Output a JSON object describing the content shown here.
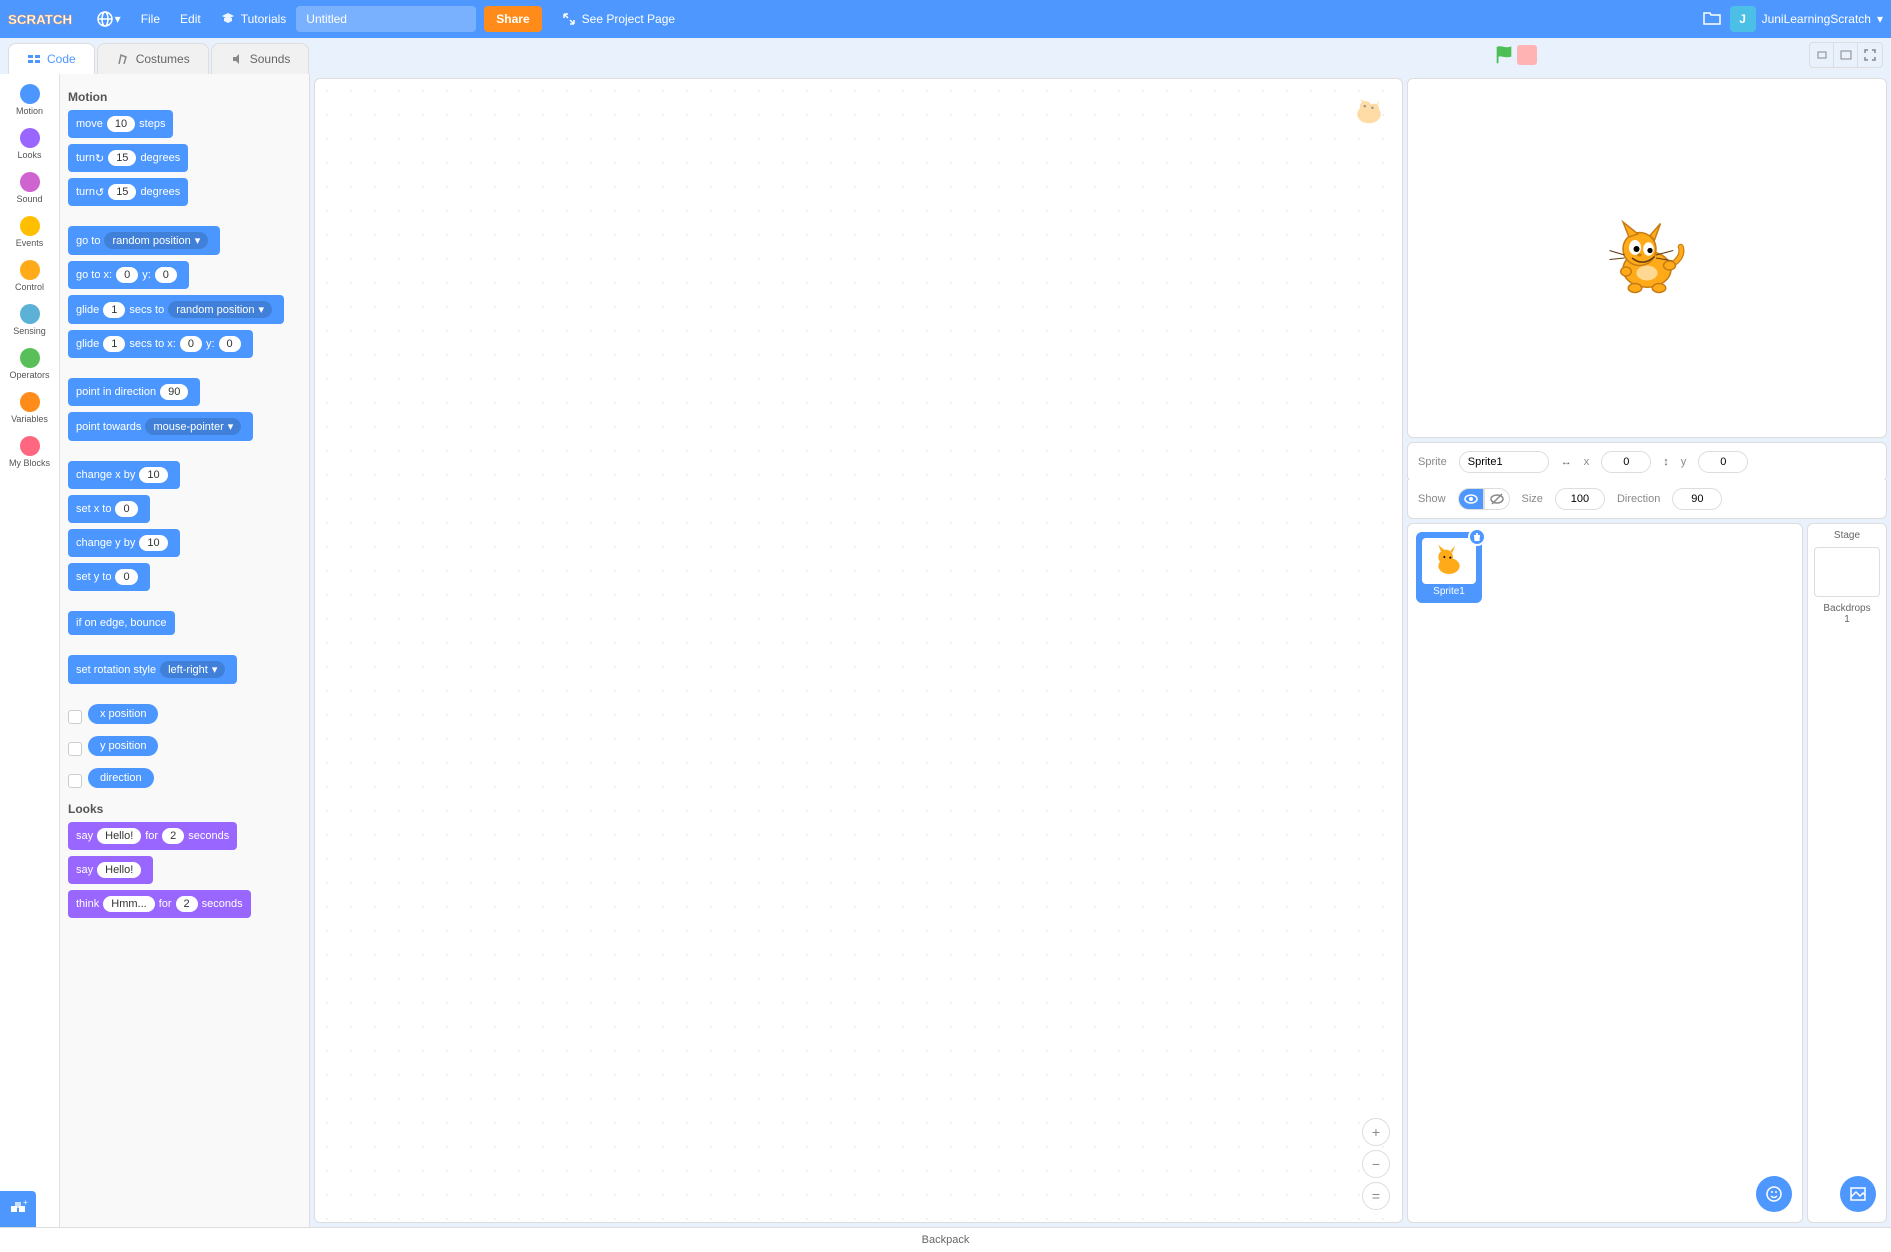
{
  "menubar": {
    "file": "File",
    "edit": "Edit",
    "tutorials": "Tutorials",
    "project_title": "Untitled",
    "share": "Share",
    "see_project": "See Project Page",
    "username": "JuniLearningScratch"
  },
  "tabs": {
    "code": "Code",
    "costumes": "Costumes",
    "sounds": "Sounds"
  },
  "categories": [
    {
      "name": "Motion",
      "color": "#4c97ff"
    },
    {
      "name": "Looks",
      "color": "#9966ff"
    },
    {
      "name": "Sound",
      "color": "#cf63cf"
    },
    {
      "name": "Events",
      "color": "#ffbf00"
    },
    {
      "name": "Control",
      "color": "#ffab19"
    },
    {
      "name": "Sensing",
      "color": "#5cb1d6"
    },
    {
      "name": "Operators",
      "color": "#59c059"
    },
    {
      "name": "Variables",
      "color": "#ff8c1a"
    },
    {
      "name": "My Blocks",
      "color": "#ff6680"
    }
  ],
  "palette": {
    "motion_header": "Motion",
    "looks_header": "Looks",
    "move": {
      "pre": "move",
      "val": "10",
      "post": "steps"
    },
    "turn_cw": {
      "pre": "turn",
      "val": "15",
      "post": "degrees"
    },
    "turn_ccw": {
      "pre": "turn",
      "val": "15",
      "post": "degrees"
    },
    "goto": {
      "pre": "go to",
      "dd": "random position"
    },
    "gotoxy": {
      "pre": "go to x:",
      "x": "0",
      "mid": "y:",
      "y": "0"
    },
    "glide_to": {
      "pre": "glide",
      "secs": "1",
      "mid": "secs to",
      "dd": "random position"
    },
    "glide_xy": {
      "pre": "glide",
      "secs": "1",
      "mid": "secs to x:",
      "x": "0",
      "mid2": "y:",
      "y": "0"
    },
    "point_dir": {
      "pre": "point in direction",
      "val": "90"
    },
    "point_towards": {
      "pre": "point towards",
      "dd": "mouse-pointer"
    },
    "change_x": {
      "pre": "change x by",
      "val": "10"
    },
    "set_x": {
      "pre": "set x to",
      "val": "0"
    },
    "change_y": {
      "pre": "change y by",
      "val": "10"
    },
    "set_y": {
      "pre": "set y to",
      "val": "0"
    },
    "bounce": "if on edge, bounce",
    "rot_style": {
      "pre": "set rotation style",
      "dd": "left-right"
    },
    "x_pos": "x position",
    "y_pos": "y position",
    "direction": "direction",
    "say_secs": {
      "pre": "say",
      "msg": "Hello!",
      "mid": "for",
      "secs": "2",
      "post": "seconds"
    },
    "say": {
      "pre": "say",
      "msg": "Hello!"
    },
    "think_secs": {
      "pre": "think",
      "msg": "Hmm...",
      "mid": "for",
      "secs": "2",
      "post": "seconds"
    }
  },
  "sprite_info": {
    "sprite_label": "Sprite",
    "sprite_name": "Sprite1",
    "x_label": "x",
    "x_val": "0",
    "y_label": "y",
    "y_val": "0",
    "show_label": "Show",
    "size_label": "Size",
    "size_val": "100",
    "direction_label": "Direction",
    "direction_val": "90"
  },
  "sprite_tile": {
    "name": "Sprite1"
  },
  "stage_selector": {
    "title": "Stage",
    "backdrops_label": "Backdrops",
    "backdrop_count": "1"
  },
  "backpack": "Backpack"
}
